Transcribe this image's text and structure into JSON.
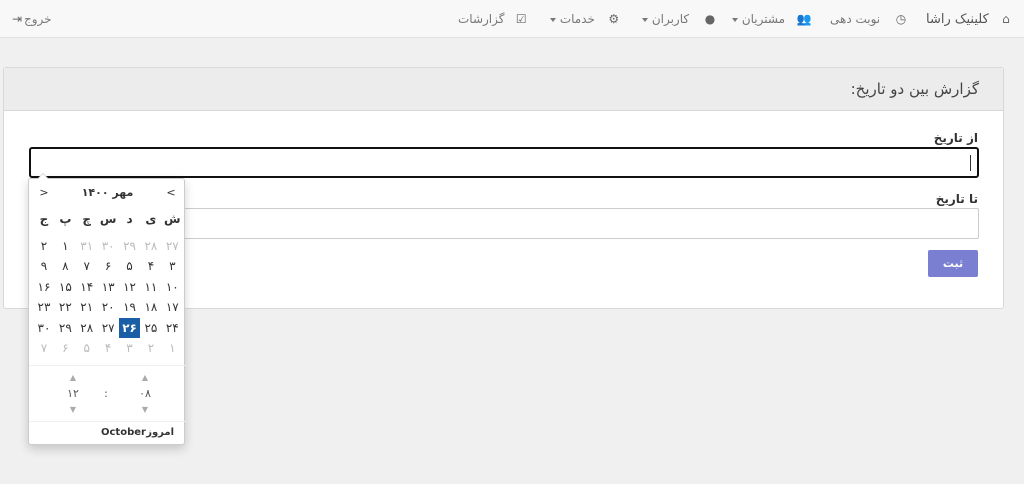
{
  "navbar": {
    "brand": "کلینیک راشا",
    "items": [
      {
        "label": "نوبت دهی",
        "icon": "clock-icon"
      },
      {
        "label": "مشتریان",
        "icon": "users-icon"
      },
      {
        "label": "کاربران",
        "icon": "user-icon"
      },
      {
        "label": "خدمات",
        "icon": "gears-icon"
      },
      {
        "label": "گزارشات",
        "icon": "check-square-icon"
      }
    ],
    "logout": "خروج"
  },
  "panel": {
    "title": "گزارش بین دو تاریخ:",
    "from_label": "از تاریخ",
    "to_label": "تا تاریخ",
    "submit": "ثبت"
  },
  "datepicker": {
    "title": "مهر ۱۴۰۰",
    "prev": "<",
    "next": ">",
    "weekdays": [
      "ش",
      "ی",
      "د",
      "س",
      "چ",
      "پ",
      "ج"
    ],
    "weeks": [
      [
        "۲۷",
        "۲۸",
        "۲۹",
        "۳۰",
        "۳۱",
        "۱",
        "۲"
      ],
      [
        "۳",
        "۴",
        "۵",
        "۶",
        "۷",
        "۸",
        "۹"
      ],
      [
        "۱۰",
        "۱۱",
        "۱۲",
        "۱۳",
        "۱۴",
        "۱۵",
        "۱۶"
      ],
      [
        "۱۷",
        "۱۸",
        "۱۹",
        "۲۰",
        "۲۱",
        "۲۲",
        "۲۳"
      ],
      [
        "۲۴",
        "۲۵",
        "۲۶",
        "۲۷",
        "۲۸",
        "۲۹",
        "۳۰"
      ],
      [
        "۱",
        "۲",
        "۳",
        "۴",
        "۵",
        "۶",
        "۷"
      ]
    ],
    "time": {
      "hour": "۰۸",
      "minute": "۱۲",
      "separator": ":"
    },
    "today_label": "امروز",
    "month_label": "October",
    "accent_color": "#1a5ea5",
    "button_color": "#7b7fd1"
  }
}
